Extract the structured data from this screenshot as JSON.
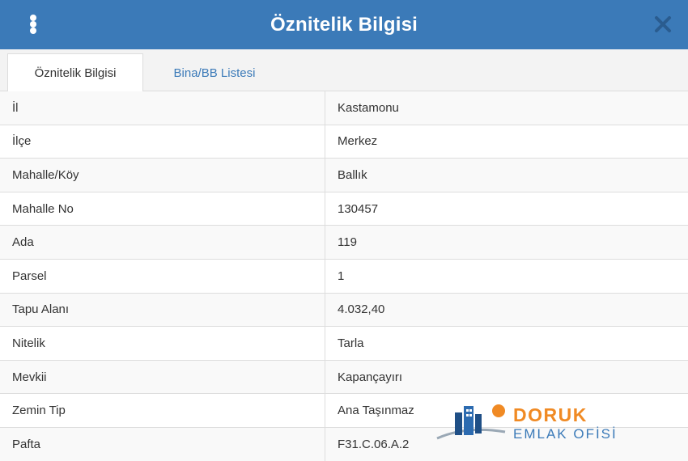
{
  "header": {
    "title": "Öznitelik Bilgisi",
    "menu_icon": "vertical-dots-icon",
    "close_icon": "close-icon"
  },
  "tabs": [
    {
      "label": "Öznitelik Bilgisi",
      "active": true
    },
    {
      "label": "Bina/BB Listesi",
      "active": false
    }
  ],
  "attributes": [
    {
      "key": "İl",
      "value": "Kastamonu"
    },
    {
      "key": "İlçe",
      "value": "Merkez"
    },
    {
      "key": "Mahalle/Köy",
      "value": "Ballık"
    },
    {
      "key": "Mahalle No",
      "value": "130457"
    },
    {
      "key": "Ada",
      "value": "119"
    },
    {
      "key": "Parsel",
      "value": "1"
    },
    {
      "key": "Tapu Alanı",
      "value": "4.032,40"
    },
    {
      "key": "Nitelik",
      "value": "Tarla"
    },
    {
      "key": "Mevkii",
      "value": "Kapançayırı"
    },
    {
      "key": "Zemin Tip",
      "value": "Ana Taşınmaz"
    },
    {
      "key": "Pafta",
      "value": "F31.C.06.A.2"
    }
  ],
  "watermark": {
    "brand": "DORUK",
    "subtitle": "EMLAK OFİSİ"
  },
  "colors": {
    "header_bg": "#3b7ab8",
    "link": "#3b7ab8",
    "brand_orange": "#f08a24",
    "row_stripe": "#f9f9f9",
    "border": "#dddddd"
  }
}
